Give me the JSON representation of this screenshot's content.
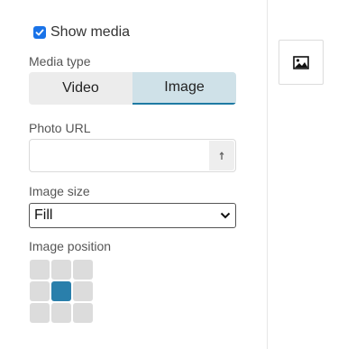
{
  "show_media": {
    "label": "Show media",
    "checked": true
  },
  "media_type": {
    "label": "Media type",
    "options": [
      "Video",
      "Image"
    ],
    "selected": "Image"
  },
  "photo_url": {
    "label": "Photo URL",
    "value": "",
    "placeholder": ""
  },
  "image_size": {
    "label": "Image size",
    "value": "Fill"
  },
  "image_position": {
    "label": "Image position",
    "selected_cell": 4
  },
  "icons": {
    "upload": "upload-icon",
    "thumbnail": "image-icon",
    "dropdown": "chevron-down-icon",
    "check": "checkmark-icon"
  },
  "colors": {
    "accent": "#1e7aa3",
    "checkbox": "#1a73e8",
    "active_cell": "#2a7fab",
    "active_segment": "#cfe1e8"
  }
}
